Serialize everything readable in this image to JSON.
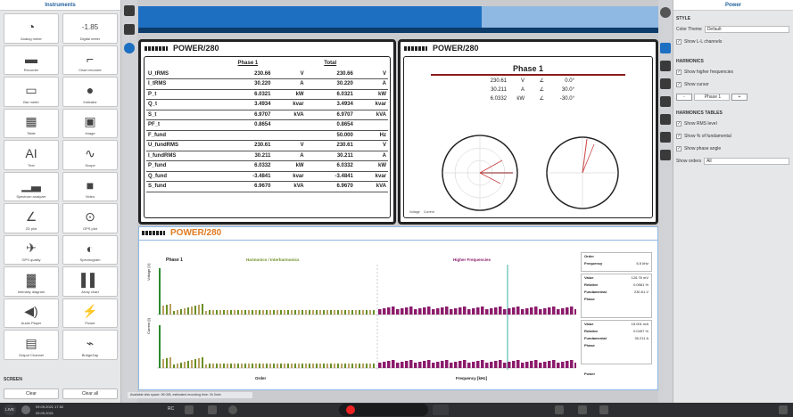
{
  "left_panel": {
    "title": "Instruments",
    "items": [
      {
        "label": "Analog meter",
        "icon": "analog-meter-icon",
        "glyph": "◔"
      },
      {
        "label": "Digital meter",
        "icon": "digital-meter-icon",
        "glyph": "-1.85"
      },
      {
        "label": "Recorder",
        "icon": "recorder-icon",
        "glyph": "▬"
      },
      {
        "label": "Chart recorder",
        "icon": "chart-recorder-icon",
        "glyph": "⌐"
      },
      {
        "label": "Bar meter",
        "icon": "bar-meter-icon",
        "glyph": "▭"
      },
      {
        "label": "Indicator",
        "icon": "indicator-icon",
        "glyph": "●"
      },
      {
        "label": "Table",
        "icon": "table-icon",
        "glyph": "▦"
      },
      {
        "label": "Image",
        "icon": "image-icon",
        "glyph": "▣"
      },
      {
        "label": "Text",
        "icon": "text-icon",
        "glyph": "AI"
      },
      {
        "label": "Scope",
        "icon": "scope-icon",
        "glyph": "∿"
      },
      {
        "label": "Spectrum analyzer",
        "icon": "spectrum-analyzer-icon",
        "glyph": "▁▃"
      },
      {
        "label": "Video",
        "icon": "video-icon",
        "glyph": "■"
      },
      {
        "label": "2D plot",
        "icon": "2d-plot-icon",
        "glyph": "∠"
      },
      {
        "label": "GPS plot",
        "icon": "gps-plot-icon",
        "glyph": "⊙"
      },
      {
        "label": "GPS quality",
        "icon": "gps-quality-icon",
        "glyph": "✈"
      },
      {
        "label": "Spectrogram",
        "icon": "spectrogram-icon",
        "glyph": "◐"
      },
      {
        "label": "Intensity diagram",
        "icon": "intensity-diagram-icon",
        "glyph": "▓"
      },
      {
        "label": "Array chart",
        "icon": "array-chart-icon",
        "glyph": "▌▌"
      },
      {
        "label": "Audio Player",
        "icon": "audio-player-icon",
        "glyph": "◀)"
      },
      {
        "label": "Power",
        "icon": "power-icon",
        "glyph": "⚡"
      },
      {
        "label": "Output Channel",
        "icon": "output-channel-icon",
        "glyph": "▤"
      },
      {
        "label": "BridgeZap",
        "icon": "bridgezap-icon",
        "glyph": "⌁"
      }
    ],
    "screen_title": "SCREEN",
    "clear_label": "Clear",
    "clear_all_label": "Clear all"
  },
  "power_table": {
    "title": "POWER/280",
    "col_phase": "Phase 1",
    "col_total": "Total",
    "rows": [
      {
        "name": "U_tRMS",
        "v1": "230.66",
        "unit1": "V",
        "v2": "230.66",
        "unit2": "V"
      },
      {
        "name": "I_tRMS",
        "v1": "30.220",
        "unit1": "A",
        "v2": "30.220",
        "unit2": "A"
      },
      {
        "name": "P_t",
        "v1": "6.0321",
        "unit1": "kW",
        "v2": "6.0321",
        "unit2": "kW"
      },
      {
        "name": "Q_t",
        "v1": "3.4934",
        "unit1": "kvar",
        "v2": "3.4934",
        "unit2": "kvar"
      },
      {
        "name": "S_t",
        "v1": "6.9707",
        "unit1": "kVA",
        "v2": "6.9707",
        "unit2": "kVA"
      },
      {
        "name": "PF_t",
        "v1": "0.8654",
        "unit1": "",
        "v2": "0.8654",
        "unit2": ""
      },
      {
        "name": "F_fund",
        "v1": "",
        "unit1": "",
        "v2": "50.000",
        "unit2": "Hz"
      },
      {
        "name": "U_fundRMS",
        "v1": "230.61",
        "unit1": "V",
        "v2": "230.61",
        "unit2": "V"
      },
      {
        "name": "I_fundRMS",
        "v1": "30.211",
        "unit1": "A",
        "v2": "30.211",
        "unit2": "A"
      },
      {
        "name": "P_fund",
        "v1": "6.0332",
        "unit1": "kW",
        "v2": "6.0332",
        "unit2": "kW"
      },
      {
        "name": "Q_fund",
        "v1": "-3.4841",
        "unit1": "kvar",
        "v2": "-3.4841",
        "unit2": "kvar"
      },
      {
        "name": "S_fund",
        "v1": "6.9670",
        "unit1": "kVA",
        "v2": "6.9670",
        "unit2": "kVA"
      }
    ]
  },
  "phasor": {
    "title": "POWER/280",
    "phase_title": "Phase 1",
    "rows": [
      {
        "val": "230.61",
        "unit": "V",
        "ang": "∠",
        "deg": "0.0°"
      },
      {
        "val": "30.211",
        "unit": "A",
        "ang": "∠",
        "deg": "30.0°"
      },
      {
        "val": "6.0332",
        "unit": "kW",
        "ang": "∠",
        "deg": "-30.0°"
      }
    ],
    "legend_voltage": "Voltage",
    "legend_current": "Current"
  },
  "harmonics": {
    "title": "POWER/280",
    "phase_label": "Phase 1",
    "harmonics_label": "Harmonics / Interharmonics",
    "higher_label": "Higher Frequencies",
    "ylabel_voltage": "Voltage [V]",
    "ylabel_current": "Current [I]",
    "xlabel_order": "Order",
    "xlabel_freq": "Frequency [kHz]",
    "side_top": [
      {
        "k": "Order",
        "v": ""
      },
      {
        "k": "Frequency",
        "v": "6.5 kHz"
      }
    ],
    "side_voltage": [
      {
        "k": "Value",
        "v": "126.76 mV"
      },
      {
        "k": "Relative",
        "v": "0.0561 %"
      },
      {
        "k": "Fundamental",
        "v": "230.61 V"
      },
      {
        "k": "Phase",
        "v": ""
      }
    ],
    "side_current": [
      {
        "k": "Value",
        "v": "15.001 mA"
      },
      {
        "k": "Relative",
        "v": "0.0497 %"
      },
      {
        "k": "Fundamental",
        "v": "30.211 A"
      },
      {
        "k": "Phase",
        "v": ""
      }
    ],
    "power_label": "Power",
    "harm_color": "#6b8e23",
    "higher_color": "#8b1a6b"
  },
  "right_panel": {
    "title": "Power",
    "style_section": "STYLE",
    "color_theme_label": "Color Theme",
    "color_theme_value": "Default",
    "show_ll": "Show L-L channels",
    "harmonics_section": "HARMONICS",
    "show_higher": "Show higher frequencies",
    "show_cursor": "Show cursor",
    "phase_selector": "Phase 1",
    "harmonics_tables_section": "HARMONICS TABLES",
    "show_rms": "Show RMS level",
    "show_pct": "Show % of fundamental",
    "show_phase": "Show phase angle",
    "show_orders_label": "Show orders",
    "show_orders_value": "All"
  },
  "status": {
    "live": "LIVE",
    "datetime1": "09.09.2021 17:52",
    "datetime2": "09.09.2021",
    "rc": "RC",
    "info": "Available disk space: 98 GiB, estimated recording time: 3h 0min"
  }
}
